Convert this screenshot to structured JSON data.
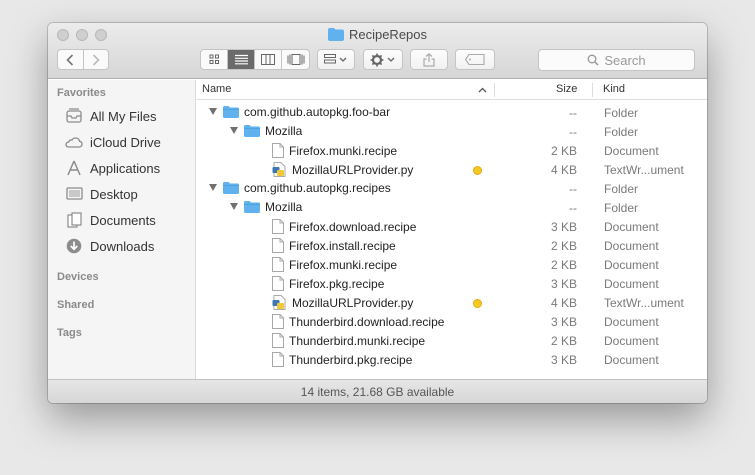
{
  "window": {
    "title": "RecipeRepos"
  },
  "toolbar": {
    "back_icon": "chevron-left-icon",
    "forward_icon": "chevron-right-icon",
    "view_modes": [
      "icon-view",
      "list-view",
      "column-view",
      "cover-flow-view"
    ],
    "active_view": "list-view",
    "search_placeholder": "Search"
  },
  "sidebar": {
    "favorites_header": "Favorites",
    "favorites": [
      {
        "label": "All My Files",
        "icon": "all-files-icon"
      },
      {
        "label": "iCloud Drive",
        "icon": "cloud-icon"
      },
      {
        "label": "Applications",
        "icon": "applications-icon"
      },
      {
        "label": "Desktop",
        "icon": "desktop-icon"
      },
      {
        "label": "Documents",
        "icon": "documents-icon"
      },
      {
        "label": "Downloads",
        "icon": "downloads-icon"
      }
    ],
    "devices_header": "Devices",
    "shared_header": "Shared",
    "tags_header": "Tags"
  },
  "columns": {
    "name": "Name",
    "size": "Size",
    "kind": "Kind"
  },
  "rows": [
    {
      "name": "com.github.autopkg.foo-bar",
      "size": "--",
      "kind": "Folder",
      "type": "folder",
      "level": 0,
      "expanded": true,
      "tag": ""
    },
    {
      "name": "Mozilla",
      "size": "--",
      "kind": "Folder",
      "type": "folder",
      "level": 1,
      "expanded": true,
      "tag": ""
    },
    {
      "name": "Firefox.munki.recipe",
      "size": "2 KB",
      "kind": "Document",
      "type": "doc",
      "level": 2,
      "tag": ""
    },
    {
      "name": "MozillaURLProvider.py",
      "size": "4 KB",
      "kind": "TextWr...ument",
      "type": "py",
      "level": 2,
      "tag": "yellow"
    },
    {
      "name": "com.github.autopkg.recipes",
      "size": "--",
      "kind": "Folder",
      "type": "folder",
      "level": 0,
      "expanded": true,
      "tag": ""
    },
    {
      "name": "Mozilla",
      "size": "--",
      "kind": "Folder",
      "type": "folder",
      "level": 1,
      "expanded": true,
      "tag": ""
    },
    {
      "name": "Firefox.download.recipe",
      "size": "3 KB",
      "kind": "Document",
      "type": "doc",
      "level": 2,
      "tag": ""
    },
    {
      "name": "Firefox.install.recipe",
      "size": "2 KB",
      "kind": "Document",
      "type": "doc",
      "level": 2,
      "tag": ""
    },
    {
      "name": "Firefox.munki.recipe",
      "size": "2 KB",
      "kind": "Document",
      "type": "doc",
      "level": 2,
      "tag": ""
    },
    {
      "name": "Firefox.pkg.recipe",
      "size": "3 KB",
      "kind": "Document",
      "type": "doc",
      "level": 2,
      "tag": ""
    },
    {
      "name": "MozillaURLProvider.py",
      "size": "4 KB",
      "kind": "TextWr...ument",
      "type": "py",
      "level": 2,
      "tag": "yellow"
    },
    {
      "name": "Thunderbird.download.recipe",
      "size": "3 KB",
      "kind": "Document",
      "type": "doc",
      "level": 2,
      "tag": ""
    },
    {
      "name": "Thunderbird.munki.recipe",
      "size": "2 KB",
      "kind": "Document",
      "type": "doc",
      "level": 2,
      "tag": ""
    },
    {
      "name": "Thunderbird.pkg.recipe",
      "size": "3 KB",
      "kind": "Document",
      "type": "doc",
      "level": 2,
      "tag": ""
    }
  ],
  "status": "14 items, 21.68 GB available",
  "colors": {
    "tag_yellow": "#f5c823",
    "folder_blue": "#5fb2ee"
  }
}
